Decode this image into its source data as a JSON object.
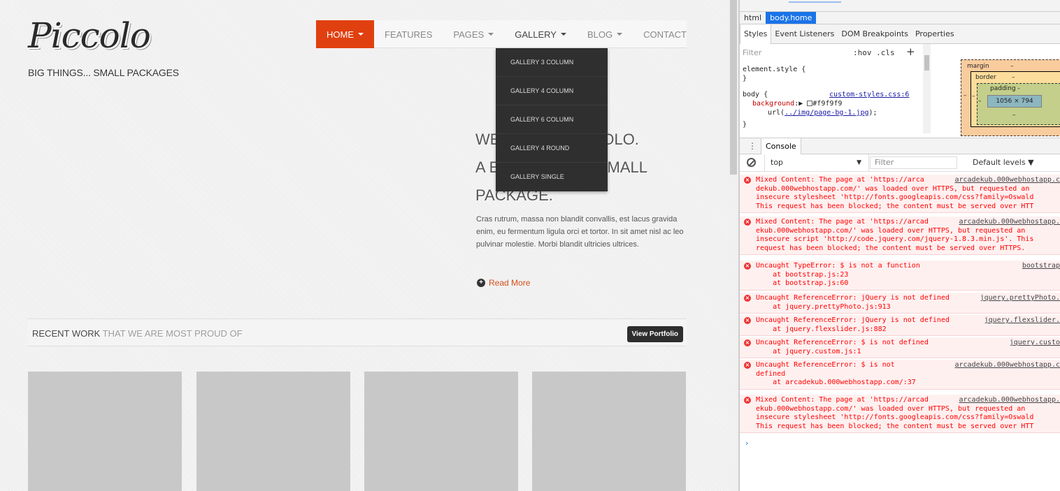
{
  "site": {
    "logo": "Piccolo",
    "tagline": "BIG THINGS... SMALL PACKAGES",
    "nav": [
      {
        "label": "HOME",
        "caret": true
      },
      {
        "label": "FEATURES",
        "caret": false
      },
      {
        "label": "PAGES",
        "caret": true
      },
      {
        "label": "GALLERY",
        "caret": true
      },
      {
        "label": "BLOG",
        "caret": true
      },
      {
        "label": "CONTACT",
        "caret": false
      }
    ],
    "gallery_menu": [
      "GALLERY 3 COLUMN",
      "GALLERY 4 COLUMN",
      "GALLERY 6 COLUMN",
      "GALLERY 4 ROUND",
      "GALLERY SINGLE"
    ],
    "welcome": {
      "line1_start": "WE",
      "line1_end": "ICCOLO.",
      "line2_start": "A E",
      "line2_end": "A SMALL",
      "line3": "PACKAGE."
    },
    "intro": "Cras rutrum, massa non blandit convallis, est lacus gravida enim, eu fermentum ligula orci et tortor. In sit amet nisl ac leo pulvinar molestie. Morbi blandit ultricies ultrices.",
    "read_more": "Read More",
    "recent": {
      "strong": "RECENT WORK",
      "light": "THAT WE ARE MOST PROUD OF"
    },
    "view_portfolio": "View Portfolio",
    "accent": "#e0400f"
  },
  "devtools": {
    "breadcrumbs": [
      "html",
      "body.home"
    ],
    "tabs": [
      "Styles",
      "Event Listeners",
      "DOM Breakpoints",
      "Properties"
    ],
    "filter": "Filter",
    "hov_cls": ":hov .cls",
    "styles": {
      "element_style": "element.style {",
      "close": "}",
      "body_selector": "body {",
      "source": "custom-styles.css:6",
      "prop": "background",
      "value_color": "#f9f9f9",
      "url_prefix": "url(",
      "url_link": "../img/page-bg-1.jpg",
      "url_suffix": ");"
    },
    "box_model": {
      "margin": "margin",
      "border": "border",
      "padding": "padding -",
      "content": "1056 × 794",
      "dash": "–"
    },
    "console_tab": "Console",
    "context": "top",
    "console_filter": "Filter",
    "levels": "Default levels ▼",
    "messages": [
      {
        "text": "Mixed Content: The page at 'https://arca",
        "link": "arcadekub.000webhostapp.c",
        "lines": [
          "dekub.000webhostapp.com/' was loaded over HTTPS, but requested an",
          "insecure stylesheet 'http://fonts.googleapis.com/css?family=Oswald",
          "This request has been blocked; the content must be served over HTT"
        ]
      },
      {
        "text": "Mixed Content: The page at 'https://arcad",
        "link": "arcadekub.000webhostapp.",
        "lines": [
          "ekub.000webhostapp.com/' was loaded over HTTPS, but requested an",
          "insecure script 'http://code.jquery.com/jquery-1.8.3.min.js'. This",
          "request has been blocked; the content must be served over HTTPS."
        ]
      },
      {
        "text": "Uncaught TypeError: $ is not a function",
        "link": "bootstrap",
        "lines": [
          "    at bootstrap.js:23",
          "    at bootstrap.js:60"
        ]
      },
      {
        "text": "Uncaught ReferenceError: jQuery is not defined",
        "link": "jquery.prettyPhoto.",
        "lines": [
          "    at jquery.prettyPhoto.js:913"
        ]
      },
      {
        "text": "Uncaught ReferenceError: jQuery is not defined",
        "link": "jquery.flexslider.",
        "lines": [
          "    at jquery.flexslider.js:882"
        ]
      },
      {
        "text": "Uncaught ReferenceError: $ is not defined",
        "link": "jquery.custo",
        "lines": [
          "    at jquery.custom.js:1"
        ]
      },
      {
        "text": "Uncaught ReferenceError: $ is not",
        "link": "arcadekub.000webhostapp.c",
        "lines": [
          "defined",
          "    at arcadekub.000webhostapp.com/:37"
        ]
      },
      {
        "text": "Mixed Content: The page at 'https://arcad",
        "link": "arcadekub.000webhostapp.",
        "lines": [
          "ekub.000webhostapp.com/' was loaded over HTTPS, but requested an",
          "insecure stylesheet 'http://fonts.googleapis.com/css?family=Oswald",
          "This request has been blocked; the content must be served over HTT"
        ]
      }
    ],
    "prompt": "›"
  }
}
